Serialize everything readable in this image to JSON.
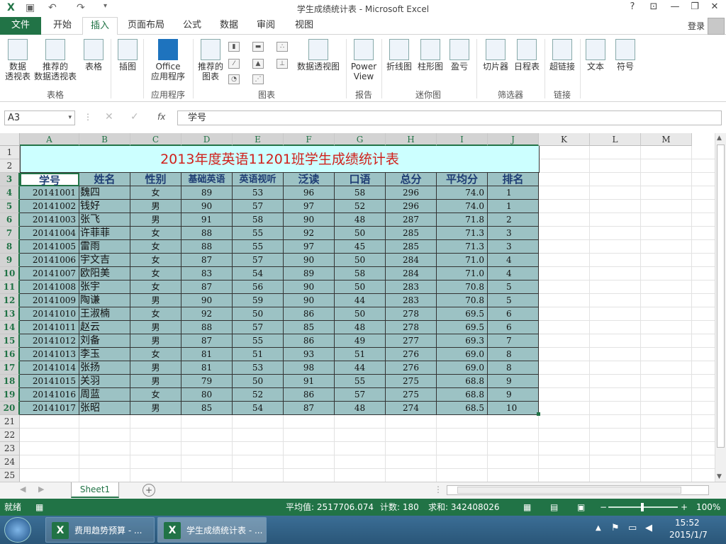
{
  "window": {
    "title": "学生成绩统计表 - Microsoft Excel",
    "help": "?",
    "controls": [
      "⊡",
      "—",
      "❐",
      "✕"
    ]
  },
  "tabs": [
    "文件",
    "开始",
    "插入",
    "页面布局",
    "公式",
    "数据",
    "审阅",
    "视图"
  ],
  "login": "登录",
  "ribbon": {
    "buttons": {
      "pivot": "数据\n透视表",
      "rec_pivot": "推荐的\n数据透视表",
      "table": "表格",
      "illustration": "插图",
      "office_apps": "Office\n应用程序",
      "rec_charts": "推荐的\n图表",
      "pivot_chart": "数据透视图",
      "power_view": "Power\nView",
      "line": "折线图",
      "column": "柱形图",
      "winloss": "盈亏",
      "slicer": "切片器",
      "timeline": "日程表",
      "hyperlink": "超链接",
      "text": "文本",
      "symbol": "符号"
    },
    "groups": {
      "tables": "表格",
      "apps": "应用程序",
      "charts": "图表",
      "reports": "报告",
      "sparklines": "迷你图",
      "filters": "筛选器",
      "links": "链接"
    }
  },
  "formula_bar": {
    "name_box": "A3",
    "formula": "学号",
    "fx": "fx"
  },
  "columns": [
    "A",
    "B",
    "C",
    "D",
    "E",
    "F",
    "G",
    "H",
    "I",
    "J",
    "K",
    "L",
    "M"
  ],
  "rows": [
    "1",
    "2",
    "3",
    "4",
    "5",
    "6",
    "7",
    "8",
    "9",
    "10",
    "11",
    "12",
    "13",
    "14",
    "15",
    "16",
    "17",
    "18",
    "19",
    "20",
    "21",
    "22",
    "23",
    "24",
    "25"
  ],
  "sheet": {
    "title": "2013年度英语11201班学生成绩统计表",
    "headers": [
      "学号",
      "姓名",
      "性别",
      "基础英语",
      "英语视听",
      "泛读",
      "口语",
      "总分",
      "平均分",
      "排名"
    ],
    "data": [
      [
        "20141001",
        "魏四",
        "女",
        "89",
        "53",
        "96",
        "58",
        "296",
        "74.0",
        "1"
      ],
      [
        "20141002",
        "钱好",
        "男",
        "90",
        "57",
        "97",
        "52",
        "296",
        "74.0",
        "1"
      ],
      [
        "20141003",
        "张飞",
        "男",
        "91",
        "58",
        "90",
        "48",
        "287",
        "71.8",
        "2"
      ],
      [
        "20141004",
        "许菲菲",
        "女",
        "88",
        "55",
        "92",
        "50",
        "285",
        "71.3",
        "3"
      ],
      [
        "20141005",
        "雷雨",
        "女",
        "88",
        "55",
        "97",
        "45",
        "285",
        "71.3",
        "3"
      ],
      [
        "20141006",
        "宇文吉",
        "女",
        "87",
        "57",
        "90",
        "50",
        "284",
        "71.0",
        "4"
      ],
      [
        "20141007",
        "欧阳美",
        "女",
        "83",
        "54",
        "89",
        "58",
        "284",
        "71.0",
        "4"
      ],
      [
        "20141008",
        "张宇",
        "女",
        "87",
        "56",
        "90",
        "50",
        "283",
        "70.8",
        "5"
      ],
      [
        "20141009",
        "陶谦",
        "男",
        "90",
        "59",
        "90",
        "44",
        "283",
        "70.8",
        "5"
      ],
      [
        "20141010",
        "王淑楠",
        "女",
        "92",
        "50",
        "86",
        "50",
        "278",
        "69.5",
        "6"
      ],
      [
        "20141011",
        "赵云",
        "男",
        "88",
        "57",
        "85",
        "48",
        "278",
        "69.5",
        "6"
      ],
      [
        "20141012",
        "刘备",
        "男",
        "87",
        "55",
        "86",
        "49",
        "277",
        "69.3",
        "7"
      ],
      [
        "20141013",
        "李玉",
        "女",
        "81",
        "51",
        "93",
        "51",
        "276",
        "69.0",
        "8"
      ],
      [
        "20141014",
        "张扬",
        "男",
        "81",
        "53",
        "98",
        "44",
        "276",
        "69.0",
        "8"
      ],
      [
        "20141015",
        "关羽",
        "男",
        "79",
        "50",
        "91",
        "55",
        "275",
        "68.8",
        "9"
      ],
      [
        "20141016",
        "周蓝",
        "女",
        "80",
        "52",
        "86",
        "57",
        "275",
        "68.8",
        "9"
      ],
      [
        "20141017",
        "张昭",
        "男",
        "85",
        "54",
        "87",
        "48",
        "274",
        "68.5",
        "10"
      ]
    ]
  },
  "sheet_tab": "Sheet1",
  "status": {
    "ready": "就绪",
    "average": "平均值: 2517706.074",
    "count": "计数: 180",
    "sum": "求和: 342408026",
    "zoom": "100%"
  },
  "taskbar": {
    "items": [
      "费用趋势预算 - ...",
      "学生成绩统计表 - ..."
    ],
    "time": "15:52",
    "date": "2015/1/7"
  },
  "colors": {
    "excel_green": "#217346",
    "cell_fill": "#9cc2c4",
    "title_fill": "#ccffff",
    "title_text": "#d0201b",
    "header_text": "#1f3e74"
  }
}
